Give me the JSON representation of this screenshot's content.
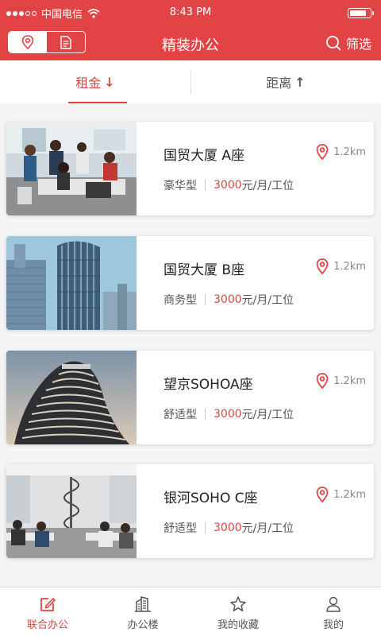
{
  "status": {
    "carrier": "中国电信",
    "time": "8:43 PM"
  },
  "nav": {
    "title": "精装办公",
    "filter_label": "筛选",
    "seg_icons": [
      "location-pin-icon",
      "document-icon"
    ]
  },
  "sort": {
    "tabs": [
      {
        "label": "租金",
        "arrow": "↓"
      },
      {
        "label": "距离",
        "arrow": "↑"
      }
    ]
  },
  "offices": [
    {
      "name": "国贸大厦 A座",
      "distance": "1.2km",
      "type": "豪华型",
      "price": "3000",
      "unit": "元/月/工位"
    },
    {
      "name": "国贸大厦 B座",
      "distance": "1.2km",
      "type": "商务型",
      "price": "3000",
      "unit": "元/月/工位"
    },
    {
      "name": "望京SOHOA座",
      "distance": "1.2km",
      "type": "舒适型",
      "price": "3000",
      "unit": "元/月/工位"
    },
    {
      "name": "银河SOHO C座",
      "distance": "1.2km",
      "type": "舒适型",
      "price": "3000",
      "unit": "元/月/工位"
    }
  ],
  "tabbar": [
    {
      "label": "联合办公",
      "icon": "edit-square-icon"
    },
    {
      "label": "办公楼",
      "icon": "building-icon"
    },
    {
      "label": "我的收藏",
      "icon": "star-icon"
    },
    {
      "label": "我的",
      "icon": "person-icon"
    }
  ],
  "colors": {
    "brand": "#e24446"
  }
}
